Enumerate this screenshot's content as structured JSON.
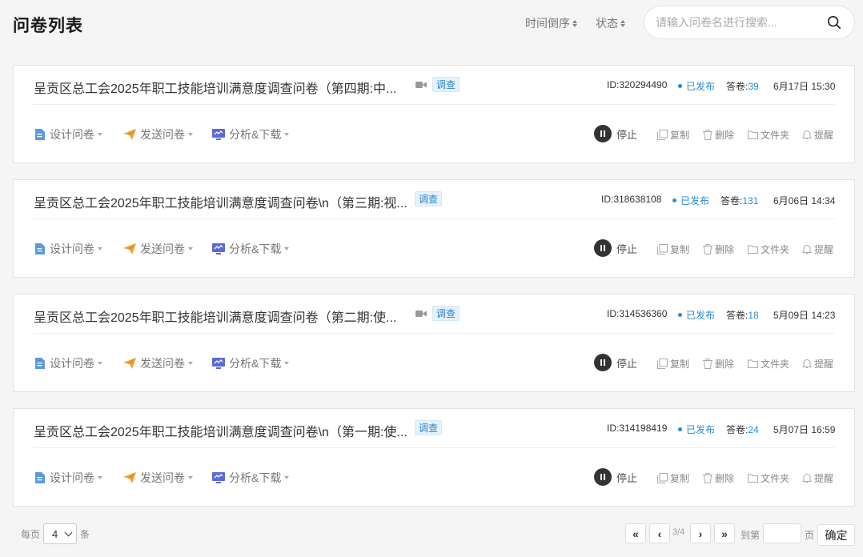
{
  "header": {
    "title": "问卷列表",
    "sort_label": "时间倒序",
    "status_label": "状态",
    "search_placeholder": "请输入问卷名进行搜索..."
  },
  "actions": {
    "design": "设计问卷",
    "send": "发送问卷",
    "analyze": "分析&下载",
    "stop": "停止",
    "copy": "复制",
    "delete": "删除",
    "folder": "文件夹",
    "remind": "提醒"
  },
  "labels": {
    "answers_prefix": "答卷:"
  },
  "surveys": [
    {
      "title": "呈贡区总工会2025年职工技能培训满意度调查问卷（第四期:中...",
      "type": "调查",
      "id": "ID:320294490",
      "status": "已发布",
      "answers": "39",
      "date": "6月17日 15:30"
    },
    {
      "title": "呈贡区总工会2025年职工技能培训满意度调查问卷\\n（第三期:视...",
      "type": "调查",
      "id": "ID:318638108",
      "status": "已发布",
      "answers": "131",
      "date": "6月06日 14:34"
    },
    {
      "title": "呈贡区总工会2025年职工技能培训满意度调查问卷（第二期:使...",
      "type": "调查",
      "id": "ID:314536360",
      "status": "已发布",
      "answers": "18",
      "date": "5月09日 14:23"
    },
    {
      "title": "呈贡区总工会2025年职工技能培训满意度调查问卷\\n（第一期:使...",
      "type": "调查",
      "id": "ID:314198419",
      "status": "已发布",
      "answers": "24",
      "date": "5月07日 16:59"
    }
  ],
  "pagination": {
    "per_page_label": "每页",
    "per_page_value": "4",
    "per_page_unit": "条",
    "first": "«",
    "prev": "‹",
    "page_info": "3/4",
    "next": "›",
    "last": "»",
    "goto_label": "到第",
    "goto_unit": "页",
    "goto_value": "",
    "confirm": "确定"
  },
  "colors": {
    "accent_blue": "#2a8ad8",
    "send_orange": "#f0a030",
    "design_blue": "#4a90d9",
    "analyze_indigo": "#5b6bd6"
  }
}
